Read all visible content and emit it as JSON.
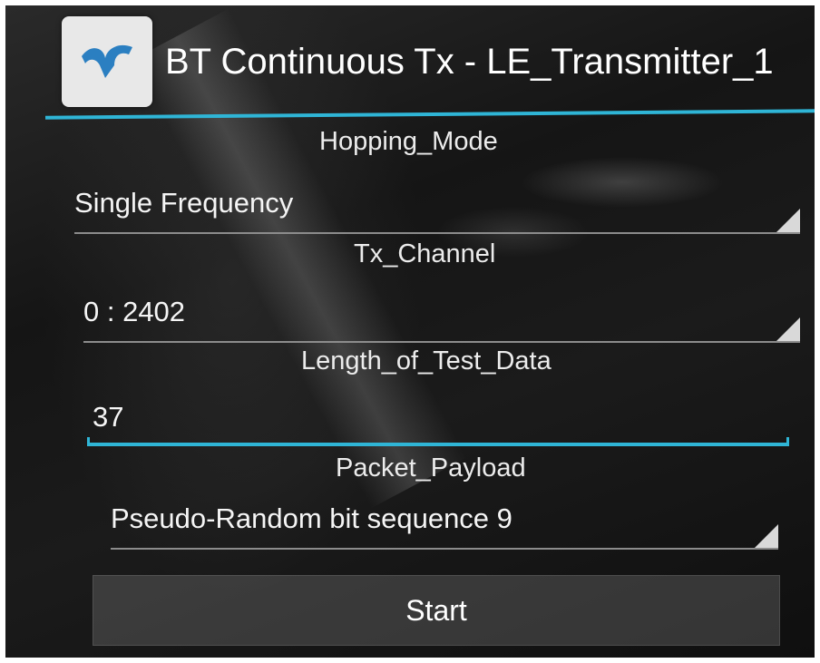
{
  "app": {
    "title": "BT Continuous Tx - LE_Transmitter_1",
    "icon": "bluetooth-app-icon",
    "accent_color": "#2fb5d6"
  },
  "form": {
    "hopping_mode": {
      "label": "Hopping_Mode",
      "value": "Single Frequency"
    },
    "tx_channel": {
      "label": "Tx_Channel",
      "value": "0 : 2402"
    },
    "length_of_test_data": {
      "label": "Length_of_Test_Data",
      "value": "37"
    },
    "packet_payload": {
      "label": "Packet_Payload",
      "value": "Pseudo-Random bit sequence 9"
    }
  },
  "actions": {
    "start_label": "Start"
  }
}
